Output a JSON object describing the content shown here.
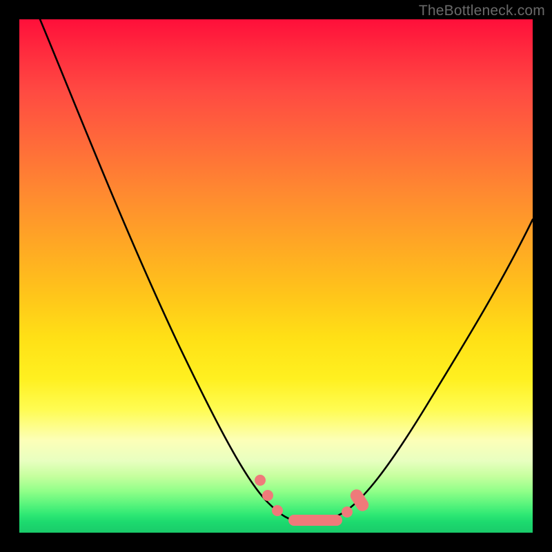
{
  "watermark": "TheBottleneck.com",
  "chart_data": {
    "type": "line",
    "title": "",
    "xlabel": "",
    "ylabel": "",
    "xlim": [
      0,
      100
    ],
    "ylim": [
      0,
      100
    ],
    "series": [
      {
        "name": "bottleneck-curve",
        "x": [
          4,
          10,
          16,
          22,
          28,
          34,
          40,
          44,
          47,
          50,
          52,
          54,
          57,
          60,
          63,
          66,
          70,
          76,
          82,
          88,
          94,
          100
        ],
        "values": [
          100,
          88,
          76,
          64,
          52,
          40,
          28,
          18,
          11,
          6,
          3,
          2,
          2,
          2,
          3,
          5,
          9,
          18,
          28,
          39,
          50,
          61
        ]
      }
    ],
    "markers": [
      {
        "name": "left-upper-dot",
        "x": 47.0,
        "y": 10.5
      },
      {
        "name": "left-mid-dot",
        "x": 48.5,
        "y": 7.0
      },
      {
        "name": "left-low-dot",
        "x": 50.5,
        "y": 4.0
      },
      {
        "name": "center-dot-1",
        "x": 53.0,
        "y": 2.2
      },
      {
        "name": "center-dot-2",
        "x": 55.0,
        "y": 2.0
      },
      {
        "name": "center-dot-3",
        "x": 57.0,
        "y": 2.0
      },
      {
        "name": "center-dot-4",
        "x": 59.0,
        "y": 2.0
      },
      {
        "name": "center-dot-5",
        "x": 61.0,
        "y": 2.2
      },
      {
        "name": "right-low-dot",
        "x": 63.5,
        "y": 4.0
      },
      {
        "name": "right-upper-1",
        "x": 65.5,
        "y": 6.5
      },
      {
        "name": "right-upper-2",
        "x": 67.0,
        "y": 9.5
      }
    ],
    "gradient_stops": [
      {
        "pos": 0,
        "color": "#ff0f3a"
      },
      {
        "pos": 50,
        "color": "#ffc61a"
      },
      {
        "pos": 80,
        "color": "#fcffb8"
      },
      {
        "pos": 100,
        "color": "#1acb6a"
      }
    ]
  }
}
